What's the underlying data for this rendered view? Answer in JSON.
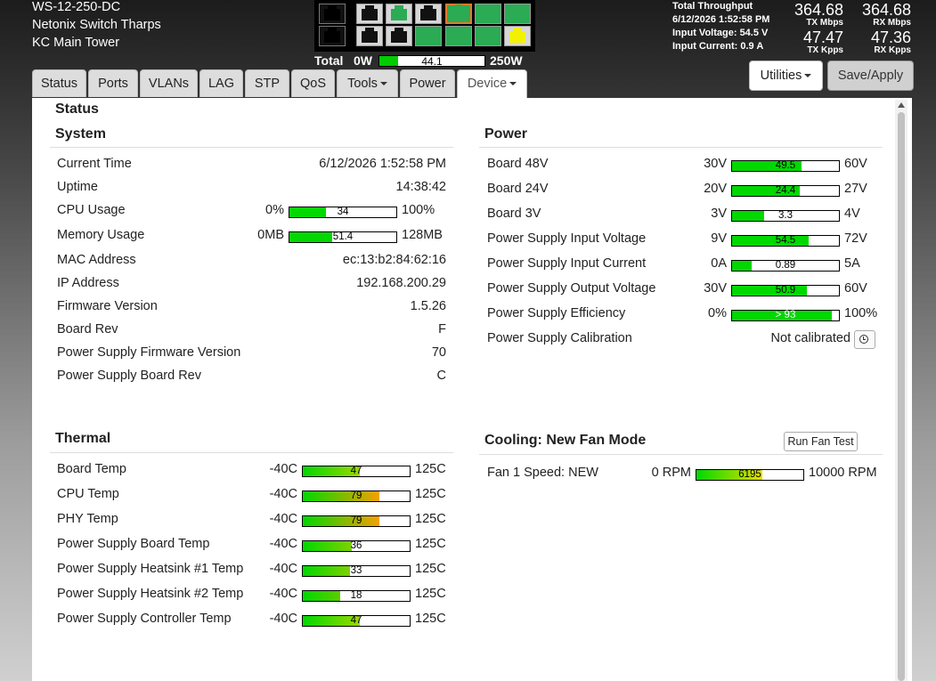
{
  "header": {
    "model": "WS-12-250-DC",
    "device_name": "Netonix Switch Tharps",
    "location": "KC Main Tower"
  },
  "ports": [
    [
      "dark",
      "light",
      "light-green",
      "light",
      "orange-green",
      "green",
      "green"
    ],
    [
      "dark",
      "light",
      "light",
      "green",
      "green",
      "green",
      "yellow"
    ]
  ],
  "power_total": {
    "label": "Total",
    "min": "0W",
    "max": "250W",
    "value": "44.1",
    "fraction": 0.176
  },
  "throughput": {
    "title": "Total Throughput",
    "timestamp": "6/12/2026 1:52:58 PM",
    "input_voltage": "Input Voltage: 54.5 V",
    "input_current": "Input Current: 0.9 A",
    "tx_mbps": "364.68",
    "tx_mbps_label": "TX Mbps",
    "rx_mbps": "364.68",
    "rx_mbps_label": "RX Mbps",
    "tx_kpps": "47.47",
    "tx_kpps_label": "TX Kpps",
    "rx_kpps": "47.36",
    "rx_kpps_label": "RX Kpps"
  },
  "tabs": [
    {
      "label": "Status"
    },
    {
      "label": "Ports"
    },
    {
      "label": "VLANs"
    },
    {
      "label": "LAG"
    },
    {
      "label": "STP"
    },
    {
      "label": "QoS"
    },
    {
      "label": "Tools"
    },
    {
      "label": "Power"
    },
    {
      "label": "Device"
    }
  ],
  "buttons": {
    "utilities": "Utilities",
    "save_apply": "Save/Apply",
    "run_fan_test": "Run Fan Test"
  },
  "page_title": "Status",
  "system": {
    "title": "System",
    "rows": [
      {
        "label": "Current Time",
        "value": "6/12/2026 1:52:58 PM"
      },
      {
        "label": "Uptime",
        "value": "14:38:42"
      },
      {
        "label": "CPU Usage",
        "min": "0%",
        "max": "100%",
        "bar": "34",
        "fraction": 0.34
      },
      {
        "label": "Memory Usage",
        "min": "0MB",
        "max": "128MB",
        "bar": "51.4",
        "fraction": 0.4
      },
      {
        "label": "MAC Address",
        "value": "ec:13:b2:84:62:16"
      },
      {
        "label": "IP Address",
        "value": "192.168.200.29"
      },
      {
        "label": "Firmware Version",
        "value": "1.5.26"
      },
      {
        "label": "Board Rev",
        "value": "F"
      },
      {
        "label": "Power Supply Firmware Version",
        "value": "70"
      },
      {
        "label": "Power Supply Board Rev",
        "value": "C"
      }
    ]
  },
  "power": {
    "title": "Power",
    "rows": [
      {
        "label": "Board 48V",
        "min": "30V",
        "max": "60V",
        "bar": "49.5",
        "fraction": 0.65
      },
      {
        "label": "Board 24V",
        "min": "20V",
        "max": "27V",
        "bar": "24.4",
        "fraction": 0.63
      },
      {
        "label": "Board 3V",
        "min": "3V",
        "max": "4V",
        "bar": "3.3",
        "fraction": 0.3
      },
      {
        "label": "Power Supply Input Voltage",
        "min": "9V",
        "max": "72V",
        "bar": "54.5",
        "fraction": 0.72
      },
      {
        "label": "Power Supply Input Current",
        "min": "0A",
        "max": "5A",
        "bar": "0.89",
        "fraction": 0.18
      },
      {
        "label": "Power Supply Output Voltage",
        "min": "30V",
        "max": "60V",
        "bar": "50.9",
        "fraction": 0.7
      },
      {
        "label": "Power Supply Efficiency",
        "min": "0%",
        "max": "100%",
        "bar": "> 93",
        "fraction": 0.93
      }
    ],
    "calibration": {
      "label": "Power Supply Calibration",
      "value": "Not calibrated"
    }
  },
  "thermal": {
    "title": "Thermal",
    "rows": [
      {
        "label": "Board Temp",
        "min": "-40C",
        "max": "125C",
        "bar": "47",
        "fraction": 0.53,
        "color": "#9cd800"
      },
      {
        "label": "CPU Temp",
        "min": "-40C",
        "max": "125C",
        "bar": "79",
        "fraction": 0.72,
        "color": "#f5a000"
      },
      {
        "label": "PHY Temp",
        "min": "-40C",
        "max": "125C",
        "bar": "79",
        "fraction": 0.72,
        "color": "#f5a000"
      },
      {
        "label": "Power Supply Board Temp",
        "min": "-40C",
        "max": "125C",
        "bar": "36",
        "fraction": 0.46,
        "color": "#80d000"
      },
      {
        "label": "Power Supply Heatsink #1 Temp",
        "min": "-40C",
        "max": "125C",
        "bar": "33",
        "fraction": 0.44,
        "color": "#7ed000"
      },
      {
        "label": "Power Supply Heatsink #2 Temp",
        "min": "-40C",
        "max": "125C",
        "bar": "18",
        "fraction": 0.35,
        "color": "#5ccc00"
      },
      {
        "label": "Power Supply Controller Temp",
        "min": "-40C",
        "max": "125C",
        "bar": "47",
        "fraction": 0.53,
        "color": "#9cd800"
      }
    ]
  },
  "cooling": {
    "title": "Cooling: New Fan Mode",
    "rows": [
      {
        "label": "Fan 1 Speed: NEW",
        "min": "0 RPM",
        "max": "10000 RPM",
        "bar": "6195",
        "fraction": 0.62,
        "color": "#e6e000"
      }
    ]
  }
}
